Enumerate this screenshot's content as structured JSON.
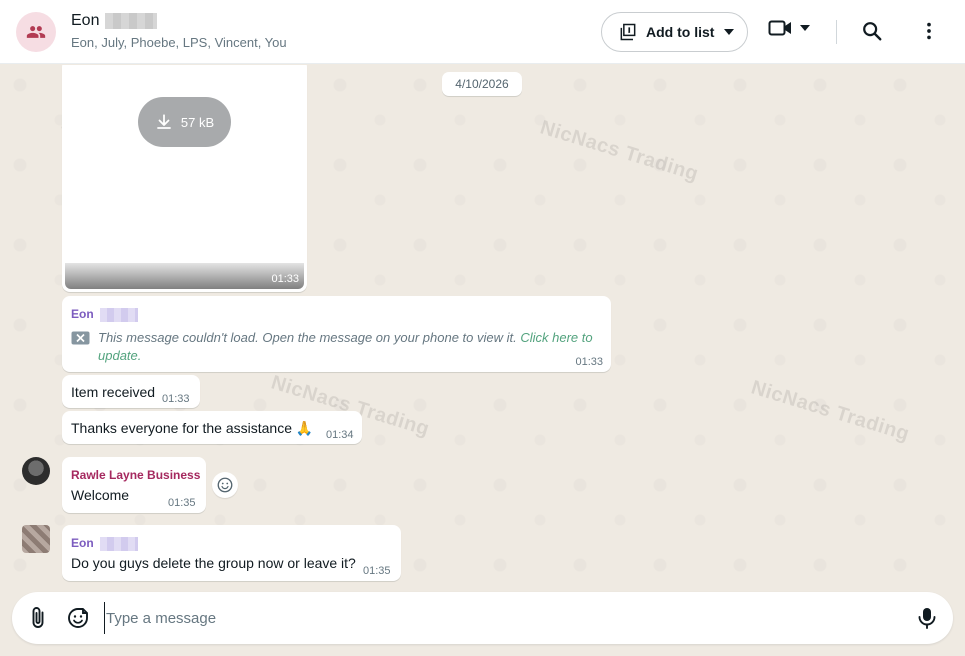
{
  "header": {
    "title": "Eon",
    "members": "Eon, July, Phoebe, LPS, Vincent, You",
    "add_to_list_label": "Add to list",
    "icons": [
      "group-icon",
      "add-to-list-icon",
      "caret-down-icon",
      "video-call-icon",
      "search-icon",
      "more-vertical-icon"
    ]
  },
  "chat": {
    "watermark": "NicNacs Trading",
    "date_chip": "4/10/2026",
    "video_message": {
      "download_size": "57 kB",
      "time": "01:33"
    },
    "error_message": {
      "sender": "Eon",
      "text": "This message couldn't load. Open the message on your phone to view it.",
      "link_part1": "Click here to",
      "link_part2": "update.",
      "time": "01:33"
    },
    "messages": [
      {
        "text": "Item received",
        "time": "01:33"
      },
      {
        "text": "Thanks everyone for the assistance 🙏",
        "time": "01:34"
      },
      {
        "sender": "Rawle Layne Business",
        "text": "Welcome",
        "time": "01:35"
      },
      {
        "sender": "Eon",
        "text": "Do you guys delete the group now or leave it?",
        "time": "01:35"
      }
    ],
    "colors": {
      "background": "#efeae2",
      "sender_rawle": "#a5295f",
      "sender_eon": "#7c5cbf",
      "group_avatar_bg": "#f6dde3",
      "group_avatar_icon": "#b23b53"
    }
  },
  "composer": {
    "placeholder": "Type a message",
    "icons": [
      "attach-icon",
      "sticker-icon",
      "microphone-icon"
    ]
  }
}
